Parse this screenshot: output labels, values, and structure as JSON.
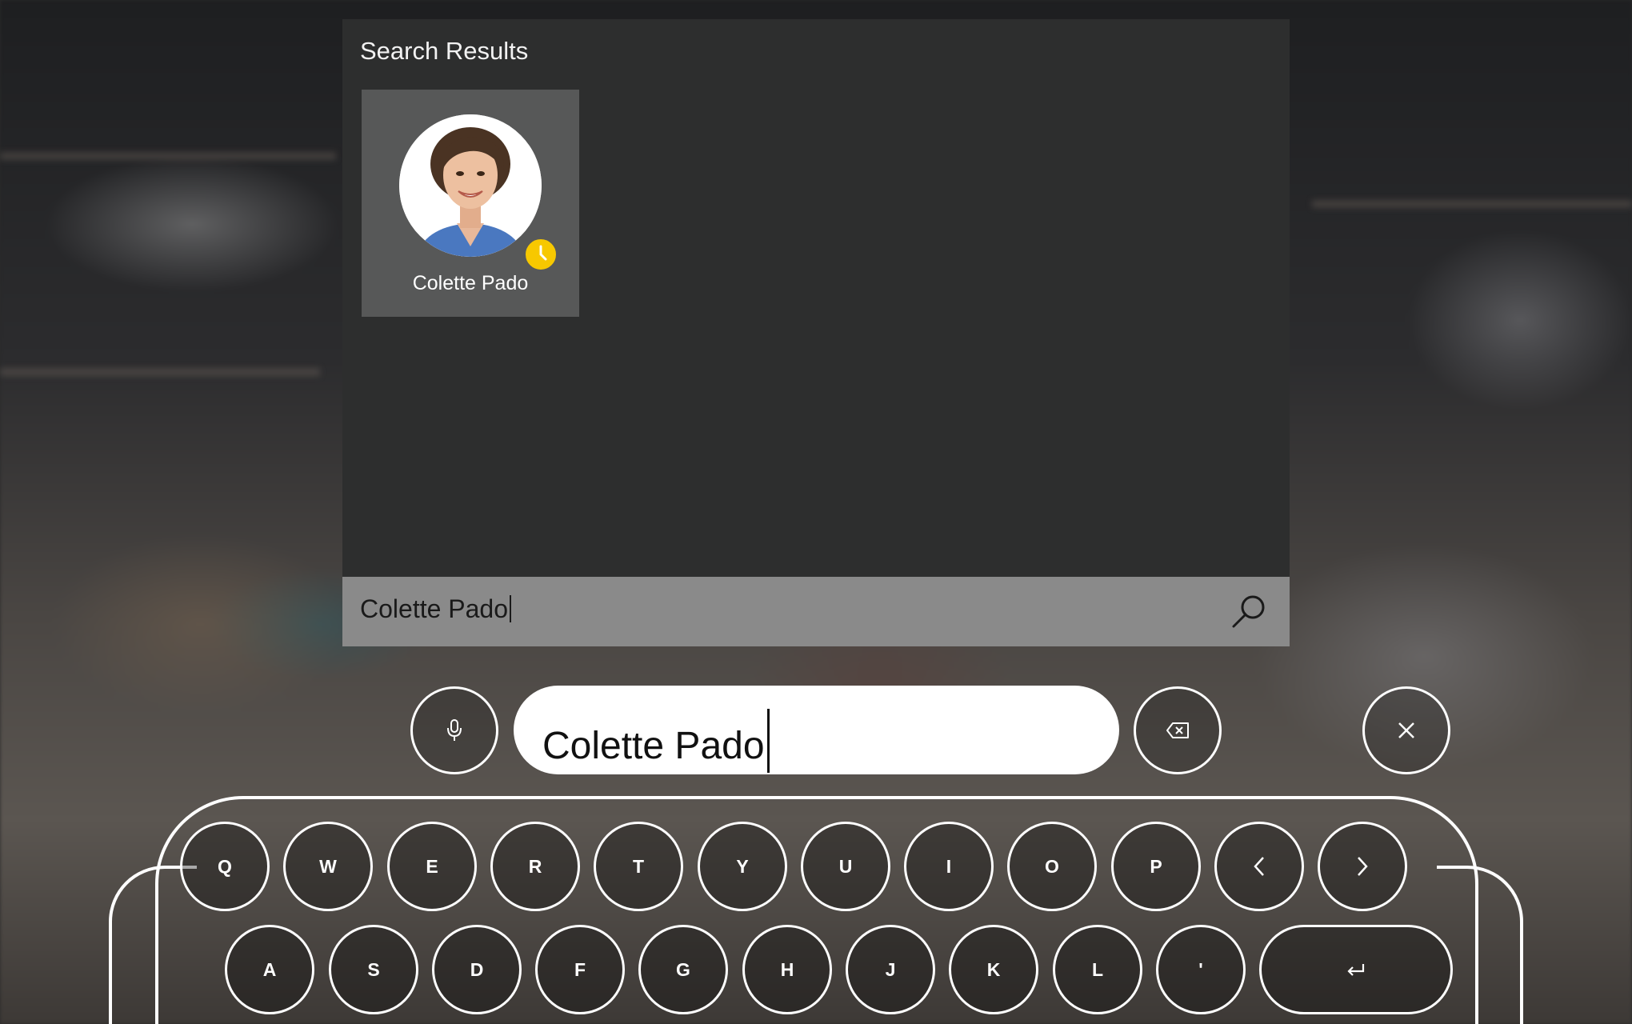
{
  "panel": {
    "title": "Search Results",
    "results": [
      {
        "name": "Colette Pado",
        "status": "away"
      }
    ]
  },
  "search": {
    "query": "Colette Pado"
  },
  "keyboard": {
    "input_value": "Colette Pado",
    "row1": [
      "Q",
      "W",
      "E",
      "R",
      "T",
      "Y",
      "U",
      "I",
      "O",
      "P"
    ],
    "row2": [
      "A",
      "S",
      "D",
      "F",
      "G",
      "H",
      "J",
      "K",
      "L",
      "'"
    ],
    "icons": {
      "mic": "microphone-icon",
      "backspace": "backspace-icon",
      "close": "close-icon",
      "left": "chevron-left-icon",
      "right": "chevron-right-icon",
      "enter": "enter-icon"
    }
  },
  "colors": {
    "panel_bg": "#2d2e2e",
    "card_bg": "#575858",
    "search_bar_bg": "#8a8a8a",
    "status_away": "#f7c800"
  }
}
